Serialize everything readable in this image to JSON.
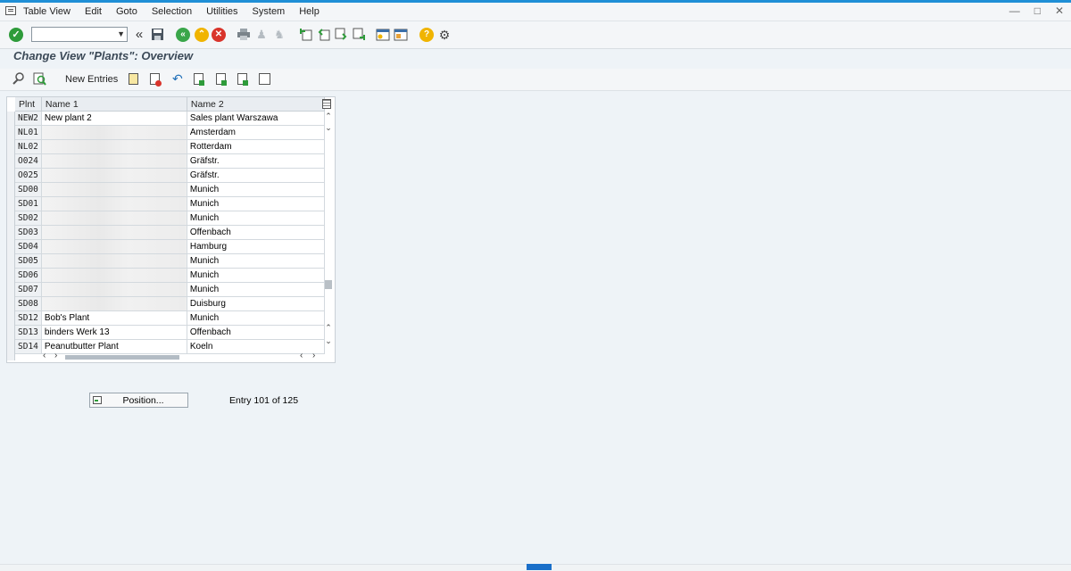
{
  "menu": [
    "Table View",
    "Edit",
    "Goto",
    "Selection",
    "Utilities",
    "System",
    "Help"
  ],
  "colors": {
    "ok_green": "#2e9b3a",
    "nav_green": "#3aa64a",
    "nav_yellow": "#f0b400",
    "cancel_red": "#d9342b",
    "help_yellow": "#f0b400",
    "accent_blue": "#1f8fd6"
  },
  "screen_title": "Change View \"Plants\": Overview",
  "app_toolbar": {
    "new_entries": "New Entries"
  },
  "table": {
    "columns": [
      "Plnt",
      "Name 1",
      "Name 2"
    ],
    "rows": [
      {
        "plnt": "NEW2",
        "name1": "New plant 2",
        "name2": "Sales plant Warszawa"
      },
      {
        "plnt": "NL01",
        "name1": "",
        "name2": "Amsterdam"
      },
      {
        "plnt": "NL02",
        "name1": "",
        "name2": "Rotterdam"
      },
      {
        "plnt": "O024",
        "name1": "",
        "name2": "Gräfstr."
      },
      {
        "plnt": "O025",
        "name1": "",
        "name2": "Gräfstr."
      },
      {
        "plnt": "SD00",
        "name1": "",
        "name2": "Munich"
      },
      {
        "plnt": "SD01",
        "name1": "",
        "name2": "Munich"
      },
      {
        "plnt": "SD02",
        "name1": "",
        "name2": "Munich"
      },
      {
        "plnt": "SD03",
        "name1": "",
        "name2": "Offenbach"
      },
      {
        "plnt": "SD04",
        "name1": "",
        "name2": "Hamburg"
      },
      {
        "plnt": "SD05",
        "name1": "",
        "name2": "Munich"
      },
      {
        "plnt": "SD06",
        "name1": "",
        "name2": "Munich"
      },
      {
        "plnt": "SD07",
        "name1": "",
        "name2": "Munich"
      },
      {
        "plnt": "SD08",
        "name1": "",
        "name2": "Duisburg"
      },
      {
        "plnt": "SD12",
        "name1": "Bob's Plant",
        "name2": "Munich"
      },
      {
        "plnt": "SD13",
        "name1": "binders Werk 13",
        "name2": "Offenbach"
      },
      {
        "plnt": "SD14",
        "name1": "Peanutbutter Plant",
        "name2": "Koeln"
      }
    ]
  },
  "position_button": "Position...",
  "entry_info": "Entry 101 of 125"
}
